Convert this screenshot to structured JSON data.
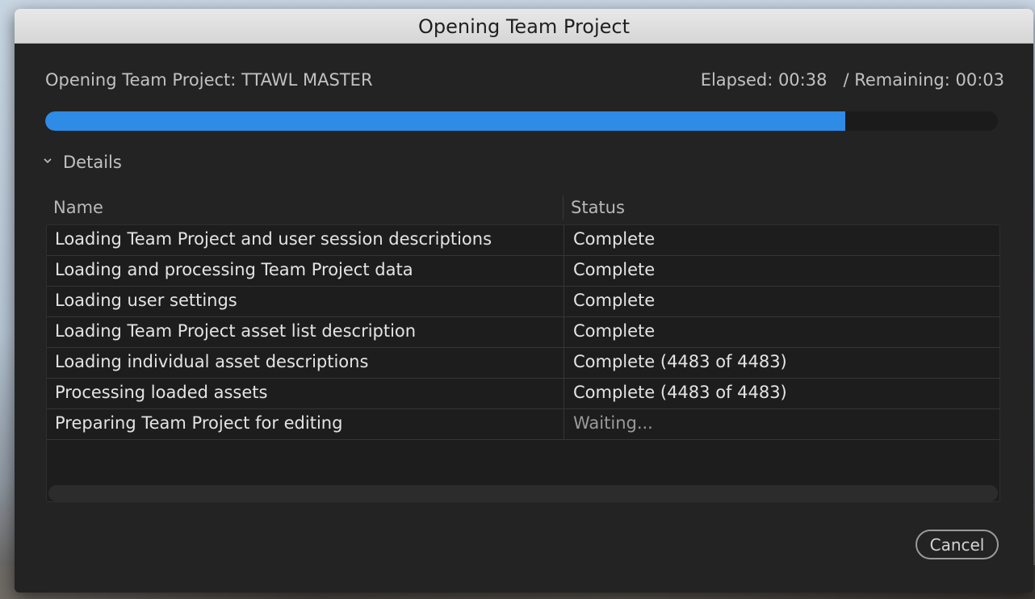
{
  "window": {
    "title": "Opening Team Project"
  },
  "header": {
    "project_label": "Opening Team Project: TTAWL MASTER",
    "elapsed": "Elapsed: 00:38",
    "remaining": "/ Remaining: 00:03"
  },
  "progress": {
    "fraction": 0.84,
    "color": "#2e8be6"
  },
  "details": {
    "label": "Details",
    "icon": "chevron-down-icon"
  },
  "table": {
    "columns": [
      "Name",
      "Status"
    ],
    "rows": [
      {
        "name": "Loading Team Project and user session descriptions",
        "status": "Complete"
      },
      {
        "name": "Loading and processing Team Project data",
        "status": "Complete"
      },
      {
        "name": "Loading user settings",
        "status": "Complete"
      },
      {
        "name": "Loading Team Project asset list description",
        "status": "Complete"
      },
      {
        "name": "Loading individual asset descriptions",
        "status": "Complete (4483 of 4483)"
      },
      {
        "name": "Processing loaded assets",
        "status": "Complete (4483 of 4483)"
      },
      {
        "name": "Preparing Team Project for editing",
        "status": "Waiting..."
      }
    ]
  },
  "footer": {
    "cancel_label": "Cancel"
  }
}
